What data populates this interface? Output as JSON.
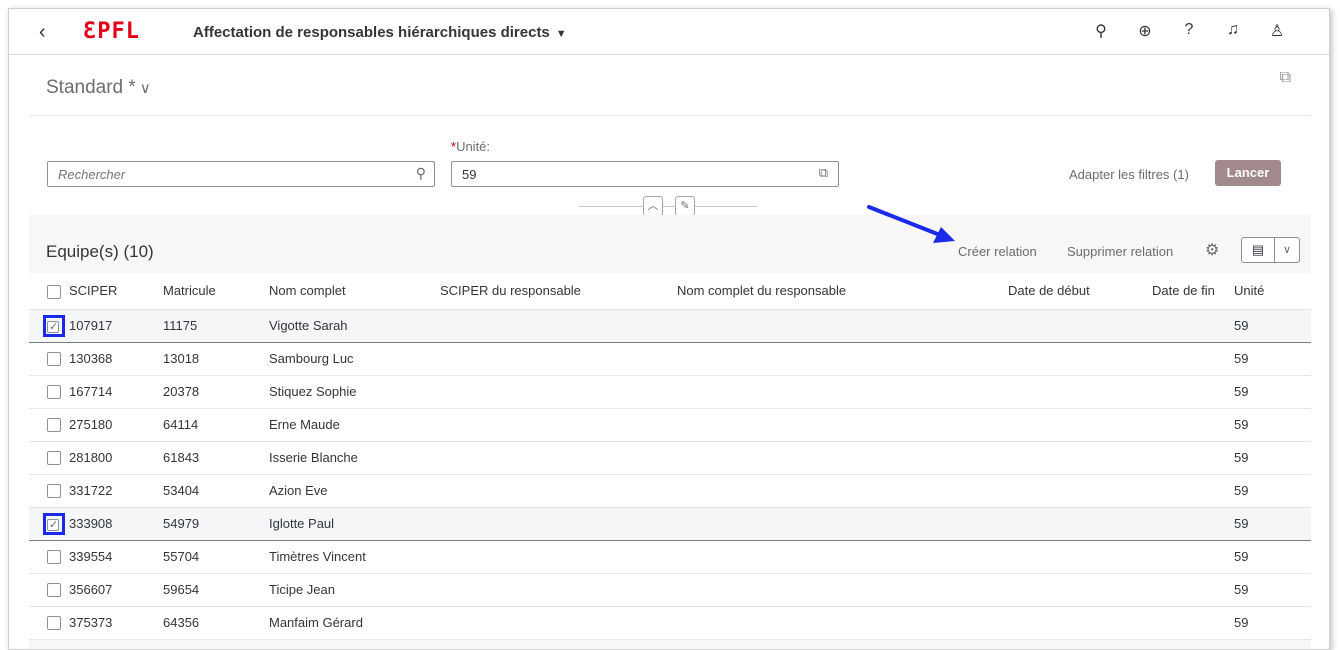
{
  "shell": {
    "back": "‹",
    "logo": "EPFL",
    "title": "Affectation de responsables hiérarchiques directs",
    "caret": "▼"
  },
  "variant": {
    "label": "Standard *",
    "chevron": "∨"
  },
  "filter": {
    "search_placeholder": "Rechercher",
    "unite_label": "Unité:",
    "unite_required": "*",
    "unite_value": "59",
    "adapt_label": "Adapter les filtres (1)",
    "go_label": "Lancer"
  },
  "table": {
    "title": "Equipe(s) (10)",
    "create_label": "Créer relation",
    "delete_label": "Supprimer relation",
    "columns": [
      "SCIPER",
      "Matricule",
      "Nom complet",
      "SCIPER du responsable",
      "Nom complet du responsable",
      "Date de début",
      "Date de fin",
      "Unité"
    ],
    "rows": [
      {
        "sciper": "107917",
        "matricule": "11175",
        "nom": "Vigotte Sarah",
        "unite": "59",
        "selected": true
      },
      {
        "sciper": "130368",
        "matricule": "13018",
        "nom": "Sambourg Luc",
        "unite": "59",
        "selected": false
      },
      {
        "sciper": "167714",
        "matricule": "20378",
        "nom": "Stiquez Sophie",
        "unite": "59",
        "selected": false
      },
      {
        "sciper": "275180",
        "matricule": "64114",
        "nom": "Erne Maude",
        "unite": "59",
        "selected": false
      },
      {
        "sciper": "281800",
        "matricule": "61843",
        "nom": "Isserie Blanche",
        "unite": "59",
        "selected": false
      },
      {
        "sciper": "331722",
        "matricule": "53404",
        "nom": "Azion Eve",
        "unite": "59",
        "selected": false
      },
      {
        "sciper": "333908",
        "matricule": "54979",
        "nom": "Iglotte Paul",
        "unite": "59",
        "selected": true
      },
      {
        "sciper": "339554",
        "matricule": "55704",
        "nom": "Timètres Vincent",
        "unite": "59",
        "selected": false
      },
      {
        "sciper": "356607",
        "matricule": "59654",
        "nom": "Ticipe Jean",
        "unite": "59",
        "selected": false
      },
      {
        "sciper": "375373",
        "matricule": "64356",
        "nom": "Manfaim Gérard",
        "unite": "59",
        "selected": false
      }
    ]
  },
  "colors": {
    "brand": "#e3001b",
    "go_button": "#a2898b",
    "highlight": "#1a2ae8"
  }
}
